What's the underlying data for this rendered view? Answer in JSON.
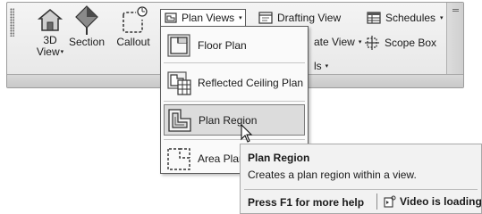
{
  "ribbon": {
    "view3d": {
      "label_line1": "3D",
      "label_line2": "View",
      "arrow": "▾"
    },
    "section": {
      "label": "Section"
    },
    "callout": {
      "label": "Callout"
    },
    "plan_views": {
      "label": "Plan Views",
      "arrow": "▾"
    },
    "drafting_view": {
      "label": "Drafting View"
    },
    "duplicate_view_partial": {
      "label": "ate View",
      "arrow": "▾"
    },
    "legends_partial": {
      "label": "ls",
      "arrow": "▾"
    },
    "schedules": {
      "label": "Schedules",
      "arrow": "▾"
    },
    "scope_box": {
      "label": "Scope Box"
    }
  },
  "menu": {
    "items": [
      {
        "label": "Floor Plan",
        "icon": "floor-plan-icon"
      },
      {
        "label": "Reflected Ceiling Plan",
        "icon": "reflected-ceiling-plan-icon"
      },
      {
        "label": "Plan Region",
        "icon": "plan-region-icon",
        "highlighted": true
      },
      {
        "label": "Area Plan",
        "icon": "area-plan-icon"
      }
    ]
  },
  "tooltip": {
    "title": "Plan Region",
    "description": "Creates a plan region within a view.",
    "help": "Press F1 for more help",
    "video": "Video is loading..."
  }
}
